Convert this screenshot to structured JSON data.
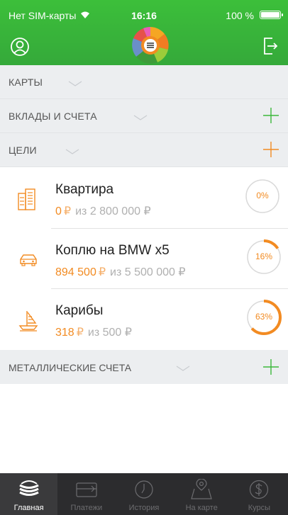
{
  "status_bar": {
    "carrier": "Нет SIM-карты",
    "time": "16:16",
    "battery": "100 %"
  },
  "header": {
    "profile_icon": "user-icon",
    "logout_icon": "logout-icon",
    "brand_color": "#3cbf3a"
  },
  "sections": [
    {
      "label": "КАРТЫ",
      "has_add": false
    },
    {
      "label": "ВКЛАДЫ И СЧЕТА",
      "has_add": true,
      "add_color": "#3cb83b"
    },
    {
      "label": "ЦЕЛИ",
      "has_add": true,
      "add_color": "#f28b22"
    }
  ],
  "goals": [
    {
      "title": "Квартира",
      "amount": "0",
      "currency": "₽",
      "of_label": "из 2 800 000 ₽",
      "progress_label": "0%",
      "progress": 0,
      "icon": "building-icon"
    },
    {
      "title": "Коплю на BMW x5",
      "amount": "894 500",
      "currency": "₽",
      "of_label": "из 5 500 000 ₽",
      "progress_label": "16%",
      "progress": 0.16,
      "icon": "car-icon"
    },
    {
      "title": "Карибы",
      "amount": "318",
      "currency": "₽",
      "of_label": "из 500 ₽",
      "progress_label": "63%",
      "progress": 0.63,
      "icon": "sailboat-icon"
    }
  ],
  "metal": {
    "label": "МЕТАЛЛИЧЕСКИЕ СЧЕТА",
    "add_color": "#3cb83b"
  },
  "tabs": [
    {
      "label": "Главная",
      "icon": "sber-logo-icon",
      "active": true
    },
    {
      "label": "Платежи",
      "icon": "card-icon",
      "active": false
    },
    {
      "label": "История",
      "icon": "clock-icon",
      "active": false
    },
    {
      "label": "На карте",
      "icon": "map-pin-icon",
      "active": false
    },
    {
      "label": "Курсы",
      "icon": "dollar-icon",
      "active": false
    }
  ]
}
